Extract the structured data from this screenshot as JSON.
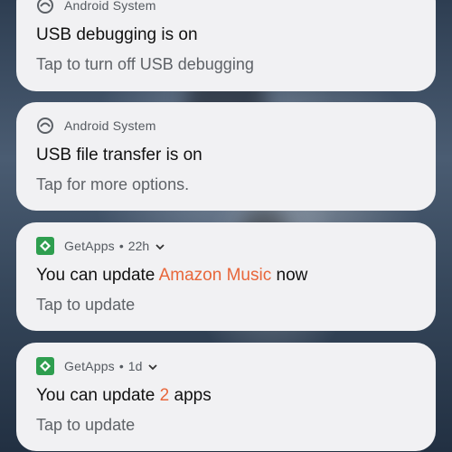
{
  "notifications": [
    {
      "app": "Android System",
      "icon": "android-system-icon",
      "title": "USB debugging is on",
      "subtitle": "Tap to turn off USB debugging"
    },
    {
      "app": "Android System",
      "icon": "android-system-icon",
      "title": "USB file transfer is on",
      "subtitle": "Tap for more options."
    },
    {
      "app": "GetApps",
      "icon": "getapps-icon",
      "time": "22h",
      "title_prefix": "You can update ",
      "title_highlight": "Amazon Music",
      "title_suffix": " now",
      "subtitle": "Tap to update"
    },
    {
      "app": "GetApps",
      "icon": "getapps-icon",
      "time": "1d",
      "title_prefix": "You can update ",
      "title_highlight": "2",
      "title_suffix": " apps",
      "subtitle": "Tap to update"
    }
  ],
  "separator": "•",
  "colors": {
    "card": "#f1f1f3",
    "accent": "#e8663a",
    "getapps_green": "#2e9e4f"
  }
}
